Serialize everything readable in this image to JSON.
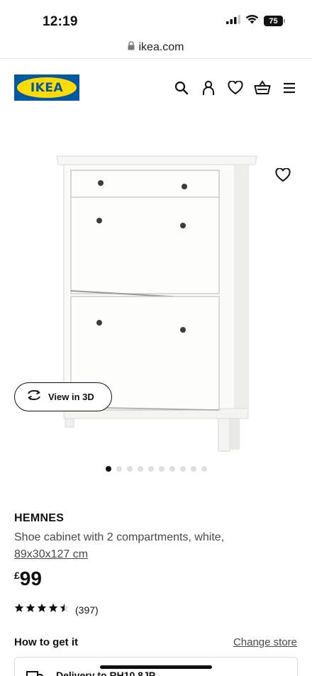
{
  "status_bar": {
    "time": "12:19",
    "battery": "75",
    "icons": [
      "signal-icon",
      "wifi-icon",
      "battery-icon"
    ]
  },
  "browser": {
    "url": "ikea.com",
    "lock_icon": "lock-icon"
  },
  "header": {
    "logo_text": "IKEA",
    "brand_colors": {
      "blue": "#0058a3",
      "yellow": "#ffdb00"
    },
    "icons": [
      "search-icon",
      "account-icon",
      "wishlist-icon",
      "basket-icon",
      "menu-icon"
    ]
  },
  "product": {
    "image_alt": "HEMNES shoe cabinet",
    "view_3d_label": "View in 3D",
    "carousel": {
      "total": 10,
      "active": 0
    },
    "name": "HEMNES",
    "description": "Shoe cabinet with 2 compartments, white,",
    "measurements": "89x30x127 cm",
    "price_currency": "£",
    "price_value": "99",
    "rating": 4.5,
    "rating_max": 5,
    "review_count": "(397)"
  },
  "fulfilment": {
    "title": "How to get it",
    "change_store_label": "Change store",
    "delivery_text": "Delivery to RH10 8JP"
  }
}
